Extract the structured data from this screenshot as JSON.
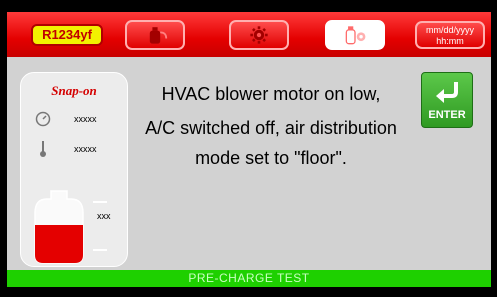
{
  "header": {
    "refrigerant": "R1234yf",
    "datetime_line1": "mm/dd/yyyy",
    "datetime_line2": "hh:mm",
    "buttons": [
      {
        "icon": "recovery-tank-icon",
        "active": false
      },
      {
        "icon": "gear-icon",
        "active": false
      },
      {
        "icon": "tank-gear-icon",
        "active": true
      }
    ]
  },
  "status_panel": {
    "logo": "Snap-on",
    "pressure_value": "xxxxx",
    "temperature_value": "xxxxx",
    "tank_value": "xxx"
  },
  "message": {
    "lines": [
      "HVAC blower motor on low,",
      "A/C switched off, air distribution",
      "mode set to \"floor\"."
    ]
  },
  "enter_button": {
    "label": "ENTER"
  },
  "footer": {
    "title": "PRE-CHARGE TEST"
  },
  "colors": {
    "header_red": "#e40000",
    "refrigerant_yellow": "#f2f200",
    "footer_green": "#1ed000",
    "enter_green": "#3fb030"
  }
}
